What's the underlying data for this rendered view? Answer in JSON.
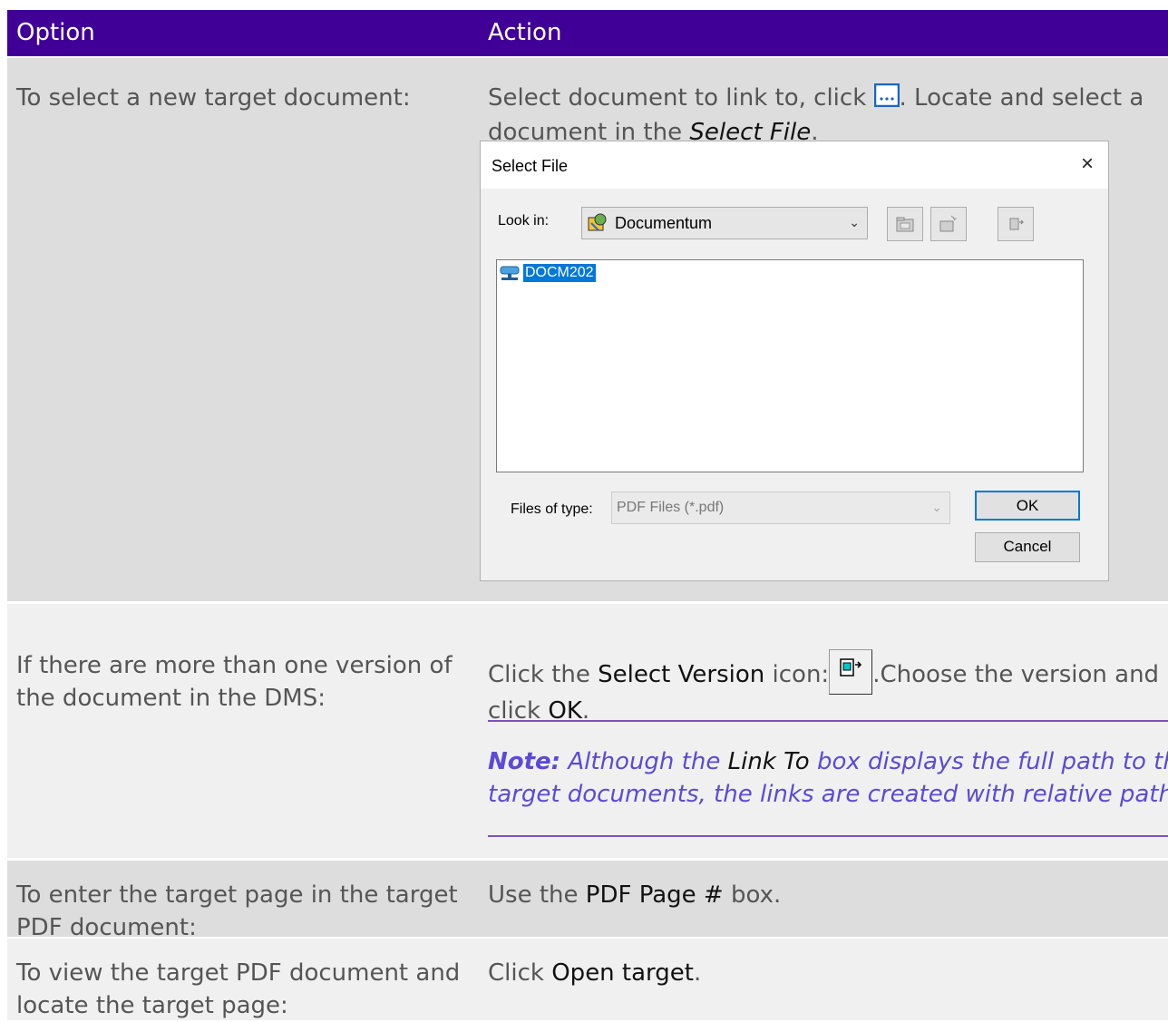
{
  "header": {
    "option": "Option",
    "action": "Action"
  },
  "rows": [
    {
      "option": "To select a new target document:",
      "action_part1": "Select document to link to, click ",
      "action_part2": ". Locate and select a",
      "action_line2_a": "document in the ",
      "action_line2_em": "Select File",
      "action_line2_b": "."
    },
    {
      "option_l1": "If there are more than one version of",
      "option_l2": "the document in the DMS:",
      "action_a": "Click the ",
      "action_b": "Select Version",
      "action_c": " icon:",
      "action_d": ".Choose the version and",
      "action_e": "click ",
      "action_f": "OK",
      "action_g": ".",
      "note_label": "Note:",
      "note_a": " Although the ",
      "note_b": "Link To",
      "note_c": " box displays the full path to the",
      "note_l2": "target documents, the links are created with relative paths."
    },
    {
      "option_l1": "To enter the target page in the target",
      "option_l2": "PDF document:",
      "action_a": "Use the ",
      "action_b": "PDF Page #",
      "action_c": " box."
    },
    {
      "option_l1": "To view the target PDF document and",
      "option_l2": "locate the target page:",
      "action_a": "Click ",
      "action_b": "Open target",
      "action_c": "."
    }
  ],
  "dialog": {
    "title": "Select File",
    "close": "×",
    "look_in_label": "Look in:",
    "look_in_value": "Documentum",
    "file_item": "DOCM202",
    "files_of_type_label": "Files of type:",
    "files_of_type_value": "PDF Files (*.pdf)",
    "ok": "OK",
    "cancel": "Cancel"
  },
  "colors": {
    "header_bg": "#400098",
    "row_dark": "#dddddd",
    "row_light": "#f0f0f0",
    "note": "#5c49d6",
    "selection": "#0078d7"
  }
}
